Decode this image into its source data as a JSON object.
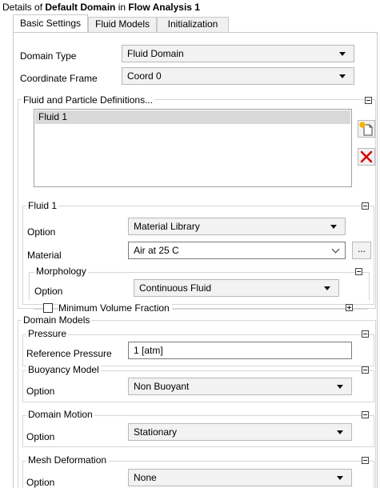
{
  "title": {
    "prefix": "Details of ",
    "object": "Default Domain",
    "mid": " in ",
    "context": "Flow Analysis 1"
  },
  "tabs": [
    {
      "label": "Basic Settings",
      "active": true
    },
    {
      "label": "Fluid Models",
      "active": false
    },
    {
      "label": "Initialization",
      "active": false
    }
  ],
  "domain_type": {
    "label": "Domain Type",
    "value": "Fluid Domain"
  },
  "coordinate_frame": {
    "label": "Coordinate Frame",
    "value": "Coord 0"
  },
  "fluid_defs": {
    "title": "Fluid and Particle Definitions...",
    "items": [
      "Fluid 1"
    ]
  },
  "fluid1": {
    "title": "Fluid 1",
    "option_label": "Option",
    "option_value": "Material Library",
    "material_label": "Material",
    "material_value": "Air at 25 C",
    "browse_label": "...",
    "morphology": {
      "title": "Morphology",
      "option_label": "Option",
      "option_value": "Continuous Fluid",
      "min_vol_label": "Minimum Volume Fraction"
    }
  },
  "domain_models": {
    "title": "Domain Models",
    "pressure": {
      "title": "Pressure",
      "ref_label": "Reference Pressure",
      "ref_value": "1 [atm]"
    },
    "buoyancy": {
      "title": "Buoyancy Model",
      "option_label": "Option",
      "option_value": "Non Buoyant"
    },
    "motion": {
      "title": "Domain Motion",
      "option_label": "Option",
      "option_value": "Stationary"
    },
    "mesh": {
      "title": "Mesh Deformation",
      "option_label": "Option",
      "option_value": "None"
    }
  },
  "icons": {
    "new": "new-document-icon",
    "delete": "red-x-delete-icon",
    "delete_color": "#d40000",
    "new_color": "#e8b800"
  }
}
